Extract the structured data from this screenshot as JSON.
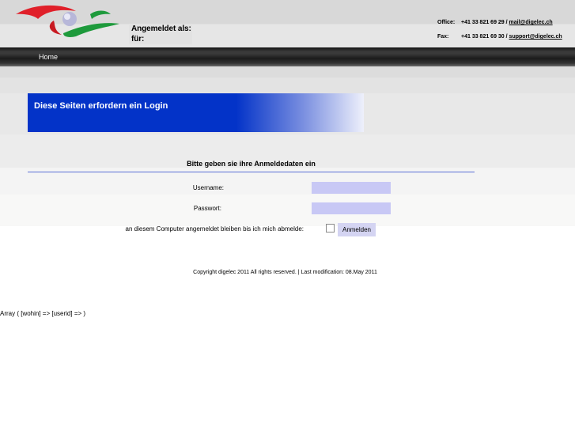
{
  "header": {
    "logged_in_label": "Angemeldet als:",
    "for_label": "für:",
    "office": {
      "label": "Office:",
      "phone": "+41 33 821 69 29",
      "separator": " / ",
      "email": "mail@digelec.ch"
    },
    "fax": {
      "label": "Fax:",
      "phone": "+41 33 821 69 30",
      "separator": " / ",
      "email": "support@digelec.ch"
    }
  },
  "nav": {
    "home": "Home"
  },
  "banner": {
    "title": "Diese Seiten erfordern ein Login"
  },
  "form": {
    "title": "Bitte geben sie ihre Anmeldedaten ein",
    "username_label": "Username:",
    "username_value": "",
    "password_label": "Passwort:",
    "password_value": "",
    "remember_label": "an diesem Computer angemeldet bleiben bis ich mich abmelde:",
    "remember_checked": false,
    "submit": "Anmelden"
  },
  "footer": {
    "copyright": "Copyright digelec 2011 All rights reserved. | Last modification: 08.May 2011"
  },
  "debug": {
    "text": "Array ( [wohin] => [userid] => )"
  },
  "colors": {
    "banner_blue": "#0333c8",
    "input_bg": "#c8c8f5",
    "nav_dark": "#1c1c1c",
    "logo_red": "#e0202a",
    "logo_green": "#1e9a3c"
  }
}
